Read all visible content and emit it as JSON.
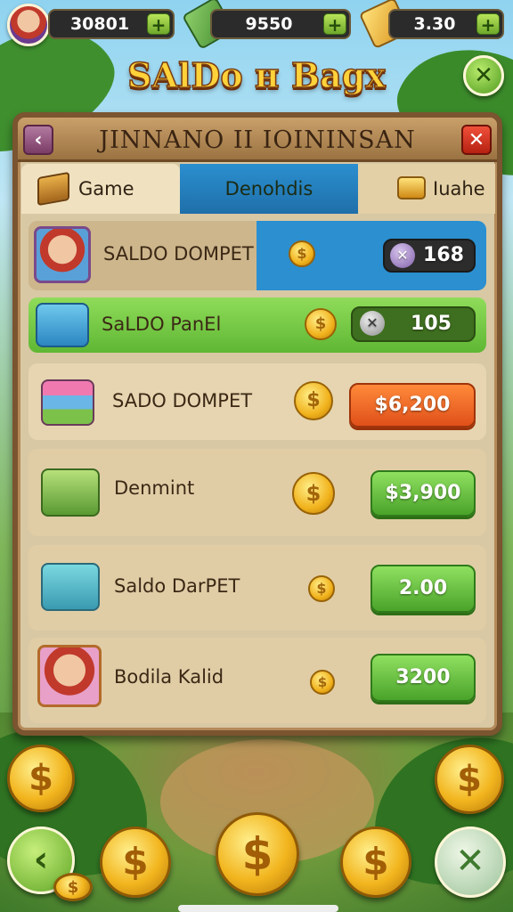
{
  "top_bar": {
    "resources": [
      {
        "value": "30801",
        "plus": "+",
        "icon": "avatar"
      },
      {
        "value": "9550",
        "plus": "+",
        "icon": "cash-icon"
      },
      {
        "value": "3.30",
        "plus": "+",
        "icon": "gold-bar-icon"
      }
    ]
  },
  "game_title": "SAlDo н Bagx",
  "close_button": "✕",
  "panel": {
    "title": "JINNANO II IOININSAN",
    "back": "‹",
    "close": "✕"
  },
  "tabs": [
    {
      "label": "Game",
      "icon": "box-icon"
    },
    {
      "label": "Denohdis",
      "selected": true
    },
    {
      "label": "Iuahe",
      "icon": "gold-bars-icon"
    }
  ],
  "rows": [
    {
      "label": "SALDO DOMPET",
      "icon": "character-avatar",
      "value": "168",
      "style": "dark"
    },
    {
      "label": "SaLDO PanEl",
      "icon": "chest-icon",
      "value": "105",
      "style": "dark"
    },
    {
      "label": "SADO DOMPET",
      "icon": "books-icon",
      "value": "$6,200",
      "style": "orange"
    },
    {
      "label": "Denmint",
      "icon": "cash-stack-icon",
      "value": "$3,900",
      "style": "green"
    },
    {
      "label": "Saldo DarPET",
      "icon": "gift-box-icon",
      "value": "2.00",
      "style": "green"
    },
    {
      "label": "Bodila Kalid",
      "icon": "character-avatar",
      "value": "3200",
      "style": "green"
    }
  ],
  "coin_symbol": "$",
  "bottom_nav": {
    "back": "‹",
    "close": "✕"
  },
  "colors": {
    "panel": "#d8c8a4",
    "border": "#7b5430",
    "title_gold": "#ffd23a",
    "button_green": "#4aa32a",
    "button_orange": "#e0501a",
    "tab_blue": "#1f6fa9"
  }
}
